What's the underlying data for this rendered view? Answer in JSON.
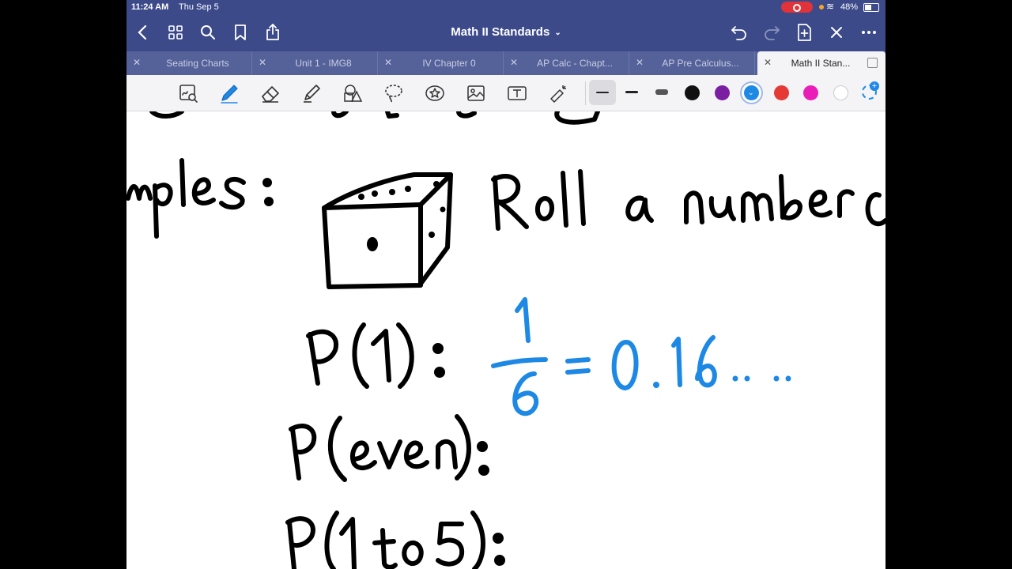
{
  "status_bar": {
    "time": "11:24 AM",
    "date": "Thu Sep 5",
    "battery_percent": "48%",
    "battery_level": 0.48
  },
  "top_bar": {
    "title": "Math II Standards",
    "left_icons": [
      "chevron-left-icon",
      "grid-icon",
      "search-icon",
      "bookmark-icon",
      "share-icon"
    ],
    "right_icons": [
      "undo-icon",
      "redo-icon",
      "add-page-icon",
      "close-icon",
      "more-icon"
    ]
  },
  "tabs": [
    {
      "label": "Seating Charts",
      "active": false
    },
    {
      "label": "Unit 1 - IMG8",
      "active": false
    },
    {
      "label": "IV Chapter 0",
      "active": false
    },
    {
      "label": "AP Calc - Chapt...",
      "active": false
    },
    {
      "label": "AP Pre Calculus...",
      "active": false
    },
    {
      "label": "Math II Stan...",
      "active": true
    }
  ],
  "toolbar": {
    "tools": [
      "zoom-window-icon",
      "pen-icon",
      "eraser-icon",
      "highlighter-icon",
      "shapes-icon",
      "lasso-icon",
      "sticker-icon",
      "image-icon",
      "text-icon",
      "laser-pointer-icon"
    ],
    "selected_tool": "pen-icon",
    "stroke_sizes": [
      "thin",
      "medium",
      "thick"
    ],
    "selected_stroke": "thin",
    "colors": [
      "#111111",
      "#7b1fa2",
      "#1e88e5",
      "#e53935",
      "#e91eb8",
      "#ffffff"
    ],
    "selected_color": "#1e88e5"
  },
  "canvas": {
    "ink_color_black": "#000000",
    "ink_color_blue": "#1e88e5",
    "handwriting": {
      "heading_fragment": "mples:",
      "example_text": "Roll a number c",
      "line_1_label": "P(1):",
      "line_1_answer": "1/6 = 0.16 ....",
      "line_2_label": "P(even):",
      "line_3_label": "P(1 to 5):"
    }
  }
}
